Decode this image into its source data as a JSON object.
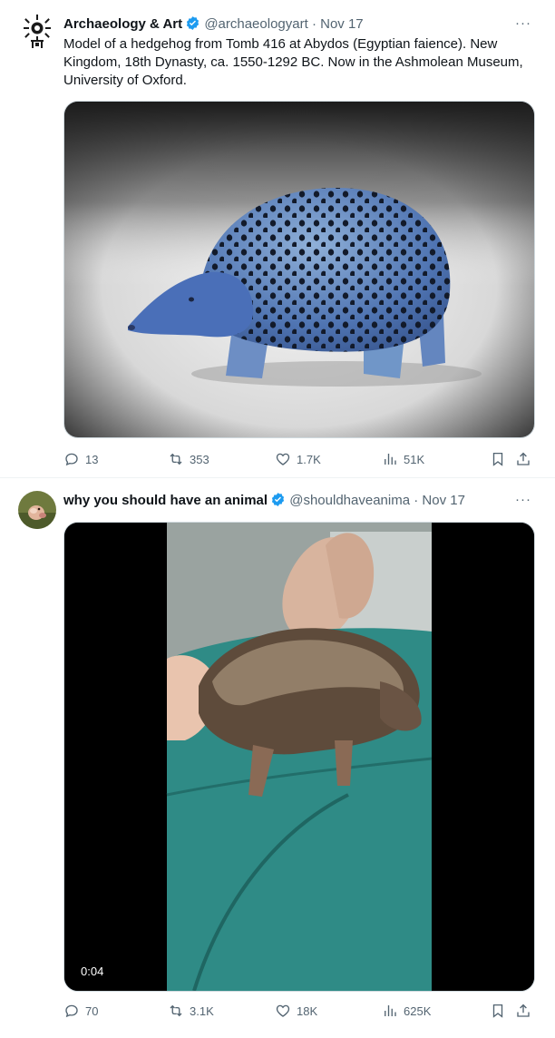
{
  "tweets": [
    {
      "author_name": "Archaeology & Art",
      "handle": "@archaeologyart",
      "separator": "·",
      "date": "Nov 17",
      "more_label": "···",
      "text": "Model of a hedgehog from Tomb 416 at Abydos (Egyptian faience). New Kingdom, 18th Dynasty, ca. 1550-1292 BC. Now in the Ashmolean Museum, University of Oxford.",
      "replies": "13",
      "reposts": "353",
      "likes": "1.7K",
      "views": "51K"
    },
    {
      "author_name": "why you should have an animal",
      "handle": "@shouldhaveanima",
      "separator": "·",
      "date": "Nov 17",
      "more_label": "···",
      "video_duration": "0:04",
      "replies": "70",
      "reposts": "3.1K",
      "likes": "18K",
      "views": "625K"
    }
  ],
  "colors": {
    "verified_blue": "#1d9bf0",
    "secondary_text": "#536471",
    "divider": "#eff3f4"
  },
  "icons": [
    "verified-badge-icon",
    "more-icon",
    "reply-icon",
    "repost-icon",
    "like-icon",
    "views-icon",
    "bookmark-icon",
    "share-icon"
  ]
}
